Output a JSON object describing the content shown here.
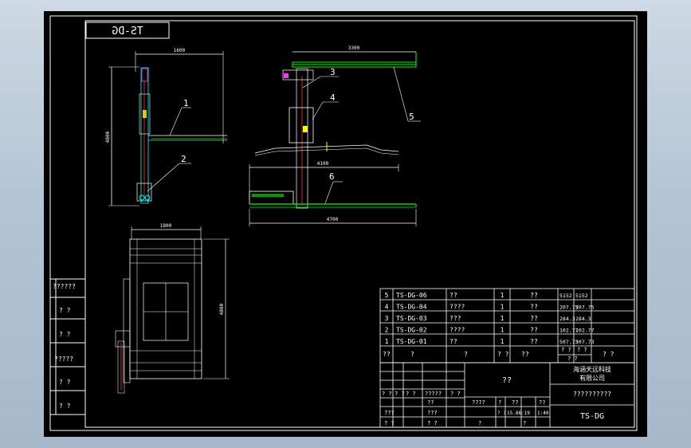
{
  "title_tag": "TS-DG",
  "callouts": [
    "1",
    "2",
    "3",
    "4",
    "5",
    "6"
  ],
  "dimensions": {
    "side_width": "1600",
    "side_height": "4800",
    "top_rail": "3300",
    "mid_span": "4100",
    "base_length": "4700",
    "plan_width": "1800",
    "plan_height": "4800"
  },
  "left_strip": [
    "??????",
    "? ?",
    "? ?",
    "?????",
    "? ?",
    "? ?"
  ],
  "bom": {
    "rows": [
      {
        "no": "5",
        "code": "TS-DG-06",
        "name": "??",
        "qty": "1",
        "mat": "??",
        "w1": "5152",
        "w2": "5152"
      },
      {
        "no": "4",
        "code": "TS-DG-04",
        "name": "????",
        "qty": "1",
        "mat": "??",
        "w1": "207.75",
        "w2": "207.75"
      },
      {
        "no": "3",
        "code": "TS-DG-03",
        "name": "???",
        "qty": "1",
        "mat": "??",
        "w1": "284.3",
        "w2": "284.3"
      },
      {
        "no": "2",
        "code": "TS-DG-02",
        "name": "????",
        "qty": "1",
        "mat": "??",
        "w1": "102.77",
        "w2": "102.77"
      },
      {
        "no": "1",
        "code": "TS-DG-01",
        "name": "??",
        "qty": "1",
        "mat": "??",
        "w1": "507.73",
        "w2": "507.73"
      }
    ],
    "header": [
      "??",
      "?",
      "?",
      "? ?",
      "??",
      "? ?",
      "? ?",
      "? ?",
      "? ?"
    ]
  },
  "title_block": {
    "drawing_name": "??",
    "company_line1": "海涵天远科技",
    "company_line2": "有限公司",
    "code_placeholder": "??????????",
    "drawing_no": "TS-DG",
    "sign_cells": [
      "? ?",
      "? ?",
      "? ?",
      "?????",
      "? ?",
      "??",
      "???",
      "? ?",
      "? ?",
      "???"
    ],
    "info_cells": [
      "????",
      "?",
      "??",
      "??",
      "? ?",
      "?",
      "?",
      "15.86:19",
      "1:40"
    ]
  },
  "colors": {
    "frame": "#ffffff",
    "line": "#00ffff",
    "text": "#ffffff",
    "accent_yellow": "#ffff00",
    "accent_green": "#00ff00",
    "accent_red": "#ff3333",
    "accent_magenta": "#ff33ff"
  }
}
